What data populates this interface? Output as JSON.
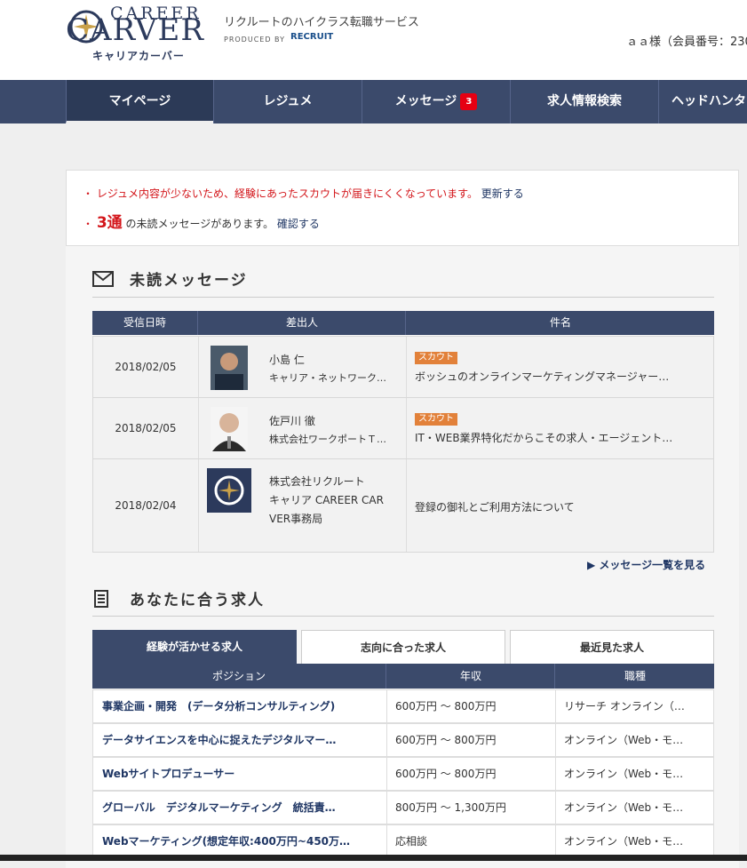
{
  "header": {
    "logo_career": "CAREER",
    "logo_carver": "CARVER",
    "logo_katakana": "キャリアカーバー",
    "tagline": "リクルートのハイクラス転職サービス",
    "produced_by": "PRODUCED BY",
    "recruit": "RECRUIT",
    "member_text": "ａａ様（会員番号：230"
  },
  "nav": {
    "items": [
      {
        "label": "マイページ"
      },
      {
        "label": "レジュメ"
      },
      {
        "label": "メッセージ",
        "badge": "3"
      },
      {
        "label": "求人情報検索"
      },
      {
        "label": "ヘッドハンタ"
      }
    ]
  },
  "notice": {
    "line1_text": "レジュメ内容が少ないため、経験にあったスカウトが届きにくくなっています。",
    "line1_link": "更新する",
    "line2_count": "3通",
    "line2_text": "の未読メッセージがあります。",
    "line2_link": "確認する"
  },
  "messages": {
    "title": "未読メッセージ",
    "columns": [
      "受信日時",
      "差出人",
      "件名"
    ],
    "rows": [
      {
        "date": "2018/02/05",
        "name": "小島 仁",
        "company": "キャリア・ネットワーク…",
        "tag": "スカウト",
        "subject": "ボッシュのオンラインマーケティングマネージャー…"
      },
      {
        "date": "2018/02/05",
        "name": "佐戸川 徹",
        "company": "株式会社ワークポートＴ…",
        "tag": "スカウト",
        "subject": "IT・WEB業界特化だからこその求人・エージェント…"
      },
      {
        "date": "2018/02/04",
        "name_line1": "株式会社リクルート",
        "name_line2": "キャリア CAREER CAR",
        "name_line3": "VER事務局",
        "subject": "登録の御礼とご利用方法について"
      }
    ],
    "more_link": "メッセージ一覧を見る"
  },
  "jobs": {
    "title": "あなたに合う求人",
    "tabs": [
      "経験が活かせる求人",
      "志向に合った求人",
      "最近見た求人"
    ],
    "columns": [
      "ポジション",
      "年収",
      "職種"
    ],
    "rows": [
      {
        "position": "事業企画・開発　(データ分析コンサルティング)",
        "salary": "600万円 ～ 800万円",
        "type": "リサーチ オンライン（…"
      },
      {
        "position": "データサイエンスを中心に捉えたデジタルマー…",
        "salary": "600万円 ～ 800万円",
        "type": "オンライン（Web・モ…"
      },
      {
        "position": "Webサイトプロデューサー",
        "salary": "600万円 ～ 800万円",
        "type": "オンライン（Web・モ…"
      },
      {
        "position": "グローバル　デジタルマーケティング　統括責…",
        "salary": "800万円 ～ 1,300万円",
        "type": "オンライン（Web・モ…"
      },
      {
        "position": "Webマーケティング(想定年収:400万円~450万…",
        "salary": "応相談",
        "type": "オンライン（Web・モ…"
      }
    ]
  },
  "colors": {
    "navy": "#3b4a6b",
    "accent_red": "#d3151a",
    "scout_orange": "#e2813a"
  }
}
